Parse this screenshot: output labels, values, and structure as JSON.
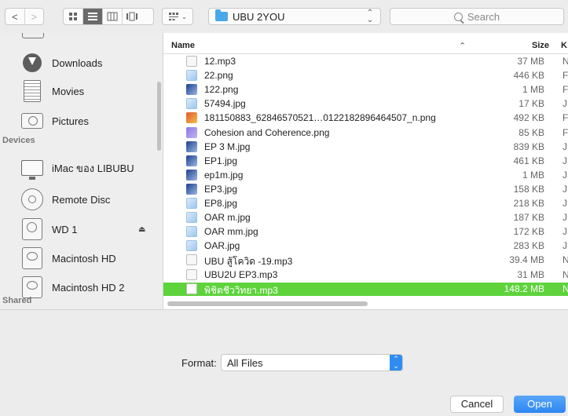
{
  "toolbar": {
    "back": "<",
    "forward": ">",
    "path_label": "UBU 2YOU",
    "search_placeholder": "Search"
  },
  "sidebar": {
    "items": [
      {
        "label": "Downloads",
        "icon": "download-icon"
      },
      {
        "label": "Movies",
        "icon": "movies-icon"
      },
      {
        "label": "Pictures",
        "icon": "pictures-icon"
      }
    ],
    "devices_header": "Devices",
    "devices": [
      {
        "label": "iMac ของ LIBUBU",
        "icon": "imac-icon"
      },
      {
        "label": "Remote Disc",
        "icon": "remote-disc-icon"
      },
      {
        "label": "WD 1",
        "icon": "drive-icon",
        "eject": "⏏"
      },
      {
        "label": "Macintosh HD",
        "icon": "hard-disk-icon"
      },
      {
        "label": "Macintosh HD 2",
        "icon": "hard-disk-icon"
      }
    ],
    "shared_header": "Shared"
  },
  "list": {
    "headers": {
      "name": "Name",
      "size": "Size",
      "kind": "K"
    },
    "rows": [
      {
        "name": "12.mp3",
        "size": "37 MB",
        "kind": "N",
        "icon": "doc"
      },
      {
        "name": "22.png",
        "size": "446 KB",
        "kind": "F",
        "icon": "img"
      },
      {
        "name": "122.png",
        "size": "1 MB",
        "kind": "F",
        "icon": "dark"
      },
      {
        "name": "57494.jpg",
        "size": "17 KB",
        "kind": "J",
        "icon": "img"
      },
      {
        "name": "181150883_62846570521…0122182896464507_n.png",
        "size": "492 KB",
        "kind": "F",
        "icon": "orange"
      },
      {
        "name": "Cohesion and Coherence.png",
        "size": "85 KB",
        "kind": "F",
        "icon": "purple"
      },
      {
        "name": "EP 3 M.jpg",
        "size": "839 KB",
        "kind": "J",
        "icon": "dark"
      },
      {
        "name": "EP1.jpg",
        "size": "461 KB",
        "kind": "J",
        "icon": "dark"
      },
      {
        "name": "ep1m.jpg",
        "size": "1 MB",
        "kind": "J",
        "icon": "dark"
      },
      {
        "name": "EP3.jpg",
        "size": "158 KB",
        "kind": "J",
        "icon": "dark"
      },
      {
        "name": "EP8.jpg",
        "size": "218 KB",
        "kind": "J",
        "icon": "img"
      },
      {
        "name": "OAR  m.jpg",
        "size": "187 KB",
        "kind": "J",
        "icon": "img"
      },
      {
        "name": "OAR mm.jpg",
        "size": "172 KB",
        "kind": "J",
        "icon": "img"
      },
      {
        "name": "OAR.jpg",
        "size": "283 KB",
        "kind": "J",
        "icon": "img"
      },
      {
        "name": "UBU สู้โควิด -19.mp3",
        "size": "39.4 MB",
        "kind": "N",
        "icon": "doc"
      },
      {
        "name": "UBU2U EP3.mp3",
        "size": "31 MB",
        "kind": "N",
        "icon": "doc"
      },
      {
        "name": "พิชิตชีววิทยา.mp3",
        "size": "148.2 MB",
        "kind": "N",
        "icon": "white",
        "selected": true
      }
    ]
  },
  "bottom": {
    "format_label": "Format:",
    "format_value": "All Files",
    "cancel_label": "Cancel",
    "open_label": "Open"
  }
}
